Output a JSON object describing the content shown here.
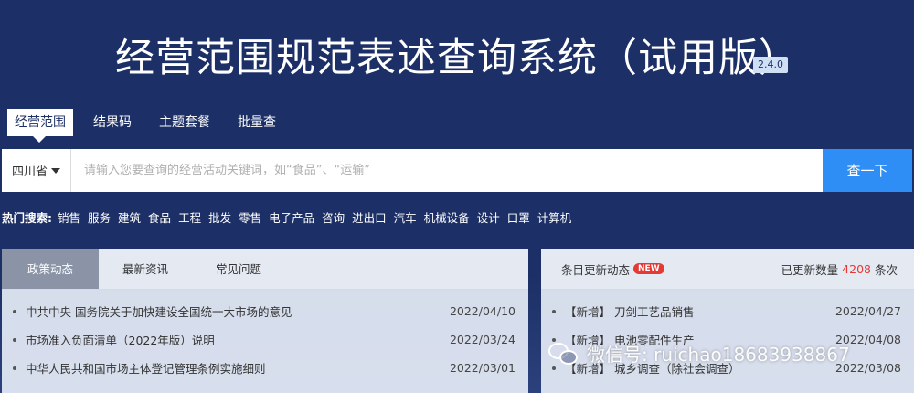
{
  "header": {
    "title": "经营范围规范表述查询系统（试用版）",
    "version": "2.4.0"
  },
  "tabs": [
    {
      "label": "经营范围",
      "active": true
    },
    {
      "label": "结果码",
      "active": false
    },
    {
      "label": "主题套餐",
      "active": false
    },
    {
      "label": "批量查",
      "active": false
    }
  ],
  "search": {
    "region": "四川省",
    "placeholder": "请输入您要查询的经营活动关键词，如“食品”、“运输”",
    "value": "",
    "button_label": "查一下"
  },
  "hot_search": {
    "label": "热门搜索:",
    "items": [
      "销售",
      "服务",
      "建筑",
      "食品",
      "工程",
      "批发",
      "零售",
      "电子产品",
      "咨询",
      "进出口",
      "汽车",
      "机械设备",
      "设计",
      "口罩",
      "计算机"
    ]
  },
  "left_panel": {
    "tabs": [
      {
        "label": "政策动态",
        "active": true
      },
      {
        "label": "最新资讯",
        "active": false
      },
      {
        "label": "常见问题",
        "active": false
      }
    ],
    "items": [
      {
        "title": "中共中央 国务院关于加快建设全国统一大市场的意见",
        "date": "2022/04/10"
      },
      {
        "title": "市场准入负面清单（2022年版）说明",
        "date": "2022/03/24"
      },
      {
        "title": "中华人民共和国市场主体登记管理条例实施细则",
        "date": "2022/03/01"
      }
    ]
  },
  "right_panel": {
    "title": "条目更新动态",
    "badge": "NEW",
    "count_prefix": "已更新数量",
    "count": "4208",
    "count_suffix": "条次",
    "items": [
      {
        "title": "【新增】 刀剑工艺品销售",
        "date": "2022/04/27"
      },
      {
        "title": "【新增】 电池零配件生产",
        "date": "2022/04/08"
      },
      {
        "title": "【新增】 城乡调查（除社会调查）",
        "date": "2022/03/08"
      }
    ]
  },
  "watermark": {
    "text": "微信号: ruichao18683938867"
  }
}
